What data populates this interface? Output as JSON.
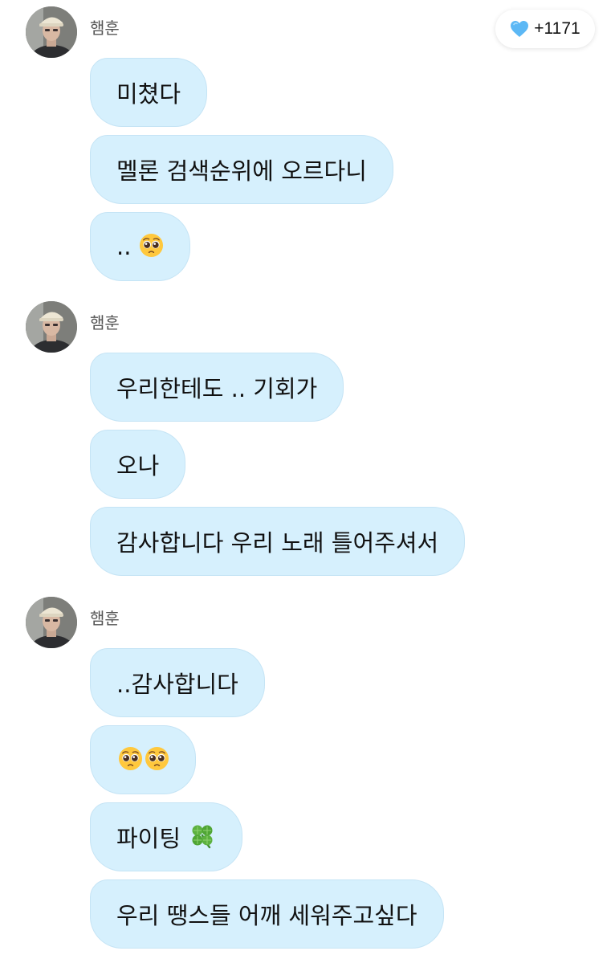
{
  "like_badge": {
    "icon": "blue-heart-icon",
    "count": "+1171",
    "heart_color": "#5cb8f5"
  },
  "bubble_color": "#d6f0fd",
  "groups": [
    {
      "sender": "햄훈",
      "avatar": "avatar-photo",
      "messages": [
        {
          "text": "미쳤다"
        },
        {
          "text": "멜론 검색순위에 오르다니"
        },
        {
          "text": "..",
          "emoji": [
            "pleading-face-icon"
          ]
        }
      ]
    },
    {
      "sender": "햄훈",
      "avatar": "avatar-photo",
      "messages": [
        {
          "text": "우리한테도 .. 기회가"
        },
        {
          "text": "오나"
        },
        {
          "text": "감사합니다 우리 노래 틀어주셔서"
        }
      ]
    },
    {
      "sender": "햄훈",
      "avatar": "avatar-photo",
      "messages": [
        {
          "text": "..감사합니다"
        },
        {
          "text": "",
          "emoji": [
            "pleading-face-icon",
            "pleading-face-icon"
          ]
        },
        {
          "text": "파이팅",
          "emoji": [
            "four-leaf-clover-icon"
          ]
        },
        {
          "text": "우리 땡스들 어깨 세워주고싶다"
        }
      ]
    }
  ]
}
